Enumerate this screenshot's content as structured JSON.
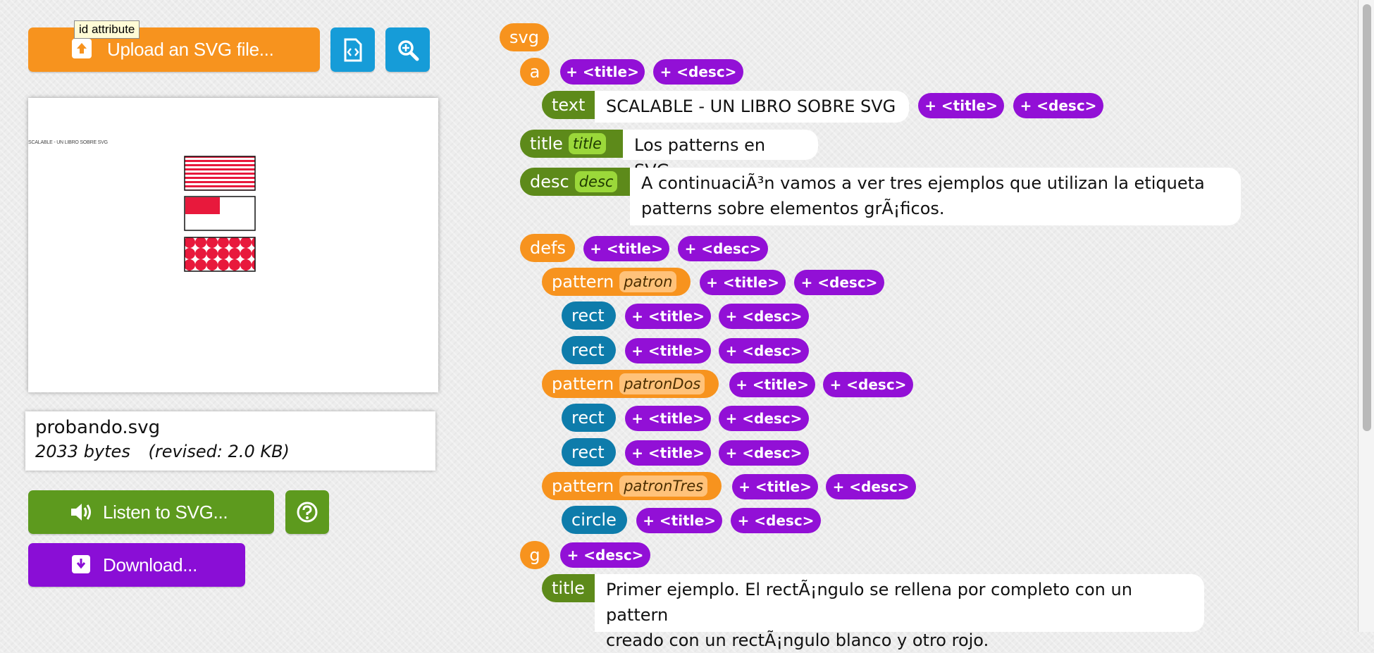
{
  "tooltip": "id attribute",
  "toolbar": {
    "upload_label": "Upload an SVG file...",
    "code_icon": "file-code-icon",
    "zoom_icon": "zoom-icon",
    "listen_label": "Listen to SVG...",
    "help_icon": "help-icon",
    "download_label": "Download..."
  },
  "preview": {
    "caption": "SCALABLE - UN LIBRO SOBRE SVG"
  },
  "file": {
    "name": "probando.svg",
    "size": "2033 bytes",
    "revised": "(revised: 2.0 KB)"
  },
  "pills": {
    "title": "+ <title>",
    "desc": "+ <desc>"
  },
  "tree": {
    "svg": "svg",
    "a": "a",
    "text": {
      "tag": "text",
      "value": "SCALABLE - UN LIBRO SOBRE SVG"
    },
    "title1": {
      "tag": "title",
      "id": "title",
      "value": "Los patterns en SVG."
    },
    "desc1": {
      "tag": "desc",
      "id": "desc",
      "value_line1": "A continuaciÃ³n vamos a ver tres ejemplos que utilizan la etiqueta",
      "value_line2": "patterns sobre elementos grÃ¡ficos."
    },
    "defs": "defs",
    "pattern1": {
      "tag": "pattern",
      "id": "patron"
    },
    "rect": "rect",
    "pattern2": {
      "tag": "pattern",
      "id": "patronDos"
    },
    "pattern3": {
      "tag": "pattern",
      "id": "patronTres"
    },
    "circle": "circle",
    "g": "g",
    "title2": {
      "tag": "title",
      "value_line1": "Primer ejemplo. El rectÃ¡ngulo se rellena por completo con un pattern",
      "value_line2": "creado con un rectÃ¡ngulo blanco y otro rojo."
    }
  },
  "colors": {
    "orange": "#f7931e",
    "blue": "#169cd8",
    "green": "#5d9a1e",
    "purple": "#8a0ed6",
    "red": "#e8193c"
  }
}
